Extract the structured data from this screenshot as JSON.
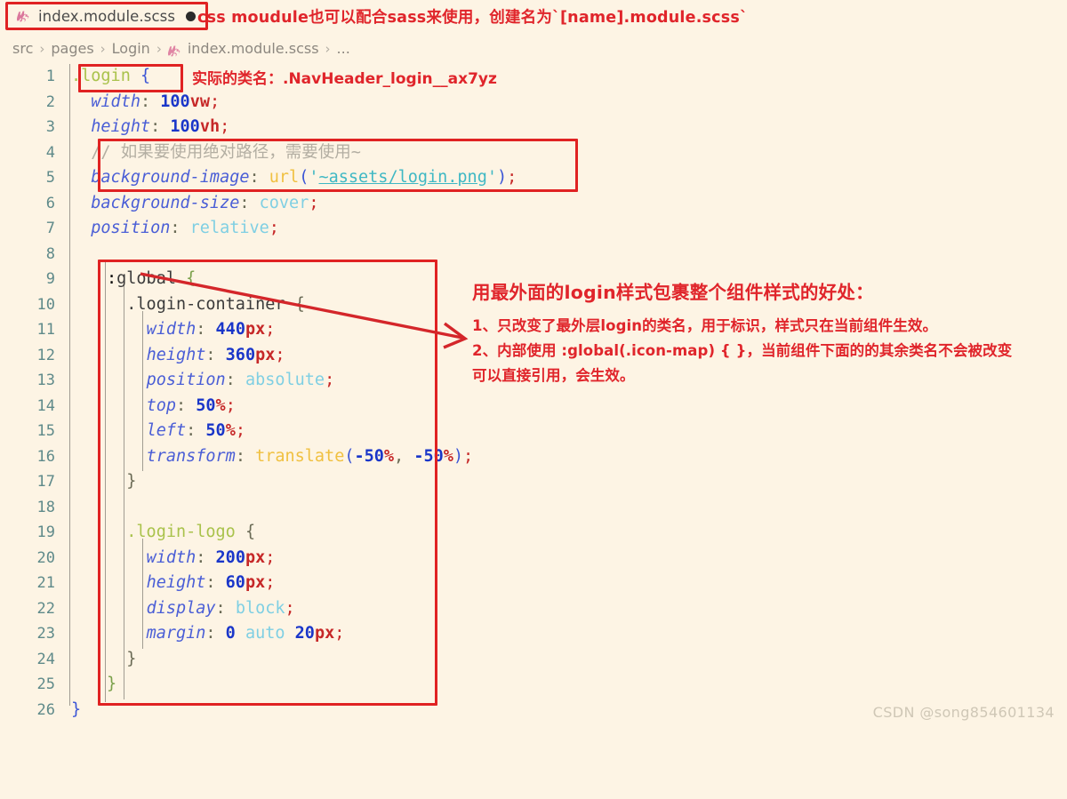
{
  "window": {
    "background_color": "#fdf4e4",
    "accent_red": "#e02222"
  },
  "tab": {
    "icon": "sass-file-icon",
    "filename": "index.module.scss",
    "dirty_indicator": "unsaved-dot"
  },
  "header_note": "css moudule也可以配合sass来使用，创建名为`[name].module.scss`",
  "breadcrumb": {
    "items": [
      {
        "label": "src",
        "icon": null
      },
      {
        "label": "pages",
        "icon": null
      },
      {
        "label": "Login",
        "icon": null
      },
      {
        "label": "index.module.scss",
        "icon": "sass-file-icon"
      },
      {
        "label": "...",
        "icon": null
      }
    ],
    "separator": "›"
  },
  "annotations": {
    "line1_note": "实际的类名：.NavHeader_login__ax7yz",
    "notes_title": "用最外面的login样式包裹整个组件样式的好处：",
    "notes": [
      "1、只改变了最外层login的类名，用于标识，样式只在当前组件生效。",
      "2、内部使用 :global(.icon-map) { }，当前组件下面的的其余类名不会被改变",
      "可以直接引用，会生效。"
    ]
  },
  "code": {
    "lines": [
      {
        "n": "1",
        "text": ".login {"
      },
      {
        "n": "2",
        "text": "  width: 100vw;"
      },
      {
        "n": "3",
        "text": "  height: 100vh;"
      },
      {
        "n": "4",
        "text": "  // 如果要使用绝对路径，需要使用~"
      },
      {
        "n": "5",
        "text": "  background-image: url('~assets/login.png');"
      },
      {
        "n": "6",
        "text": "  background-size: cover;"
      },
      {
        "n": "7",
        "text": "  position: relative;"
      },
      {
        "n": "8",
        "text": ""
      },
      {
        "n": "9",
        "text": "  :global {"
      },
      {
        "n": "10",
        "text": "    .login-container {"
      },
      {
        "n": "11",
        "text": "      width: 440px;"
      },
      {
        "n": "12",
        "text": "      height: 360px;"
      },
      {
        "n": "13",
        "text": "      position: absolute;"
      },
      {
        "n": "14",
        "text": "      top: 50%;"
      },
      {
        "n": "15",
        "text": "      left: 50%;"
      },
      {
        "n": "16",
        "text": "      transform: translate(-50%, -50%);"
      },
      {
        "n": "17",
        "text": "    }"
      },
      {
        "n": "18",
        "text": ""
      },
      {
        "n": "19",
        "text": "    .login-logo {"
      },
      {
        "n": "20",
        "text": "      width: 200px;"
      },
      {
        "n": "21",
        "text": "      height: 60px;"
      },
      {
        "n": "22",
        "text": "      display: block;"
      },
      {
        "n": "23",
        "text": "      margin: 0 auto 20px;"
      },
      {
        "n": "24",
        "text": "    }"
      },
      {
        "n": "25",
        "text": "  }"
      },
      {
        "n": "26",
        "text": "}"
      }
    ]
  },
  "watermark": "CSDN @song854601134"
}
